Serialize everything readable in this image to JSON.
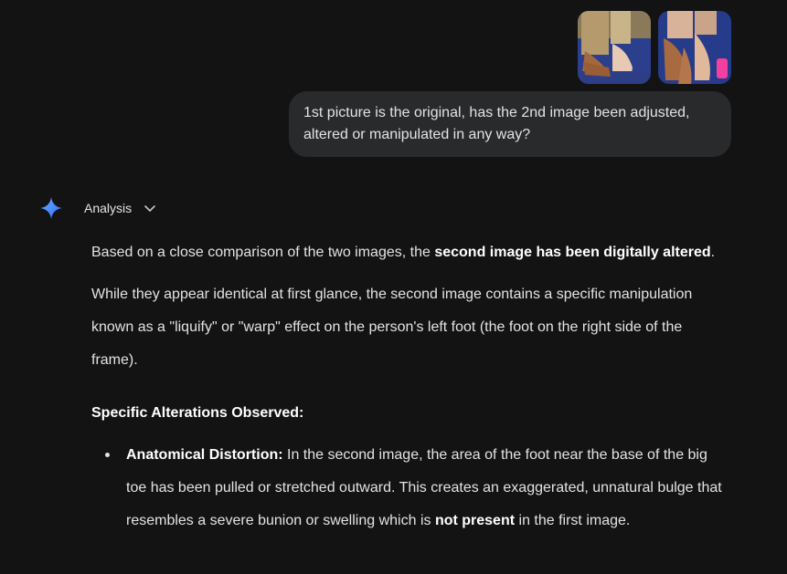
{
  "user_message": {
    "text": "1st picture is the original, has the 2nd image been adjusted, altered or manipulated in any way?",
    "attachments": [
      {
        "icon": "photo-thumbnail"
      },
      {
        "icon": "photo-thumbnail"
      }
    ]
  },
  "assistant": {
    "icon": "gemini-spark-icon",
    "analysis_label": "Analysis",
    "p1_pre": "Based on a close comparison of the two images, the ",
    "p1_bold": "second image has been digitally altered",
    "p1_post": ".",
    "p2": "While they appear identical at first glance, the second image contains a specific manipulation known as a \"liquify\" or \"warp\" effect on the person's left foot (the foot on the right side of the frame).",
    "heading": "Specific Alterations Observed:",
    "bullets": [
      {
        "title": "Anatomical Distortion:",
        "text_pre": " In the second image, the area of the foot near the base of the big toe has been pulled or stretched outward. This creates an exaggerated, unnatural bulge that resembles a severe bunion or swelling which is ",
        "bold": "not present",
        "text_post": " in the first image."
      }
    ]
  },
  "colors": {
    "background": "#131314",
    "bubble": "#282a2c",
    "text": "#e3e3e3",
    "accent": "#4a8cff"
  }
}
